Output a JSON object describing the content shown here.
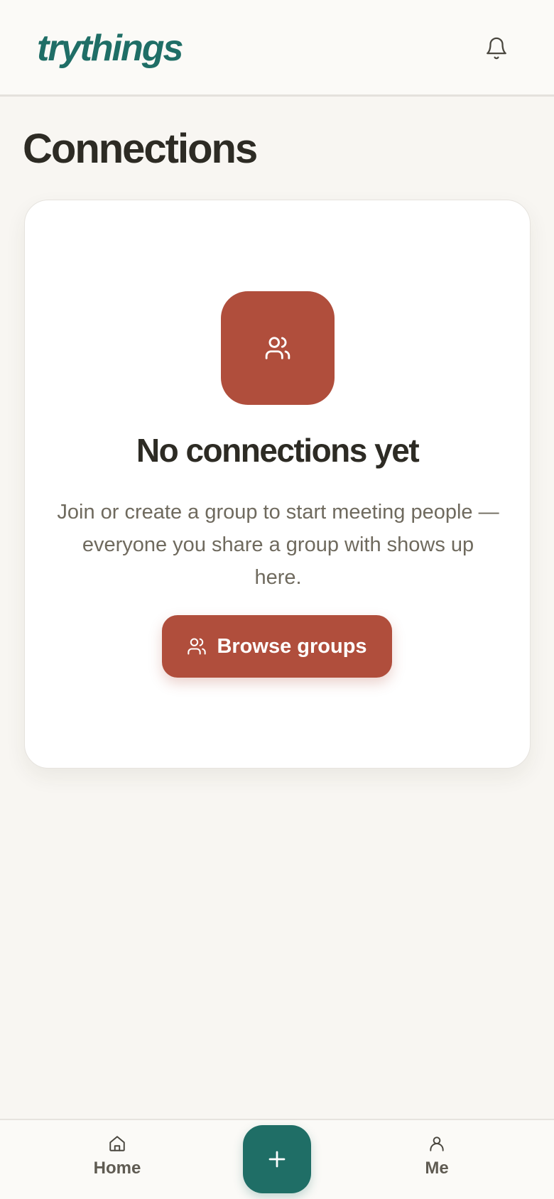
{
  "app": {
    "logo_text": "trythings"
  },
  "header": {
    "notifications_icon": "bell-icon"
  },
  "page": {
    "title": "Connections"
  },
  "empty_state": {
    "icon": "users-icon",
    "title": "No connections yet",
    "description": "Join or create a group to start meeting people — everyone you share a group with shows up here.",
    "button_label": "Browse groups",
    "button_icon": "users-icon"
  },
  "bottom_nav": {
    "home_label": "Home",
    "home_icon": "home-icon",
    "create_icon": "plus-icon",
    "me_label": "Me",
    "me_icon": "user-icon"
  },
  "colors": {
    "brand": "#1f6e66",
    "accent": "#b04e3c",
    "background": "#f8f6f2",
    "text": "#2d2b24",
    "muted_text": "#6f6a5e"
  }
}
